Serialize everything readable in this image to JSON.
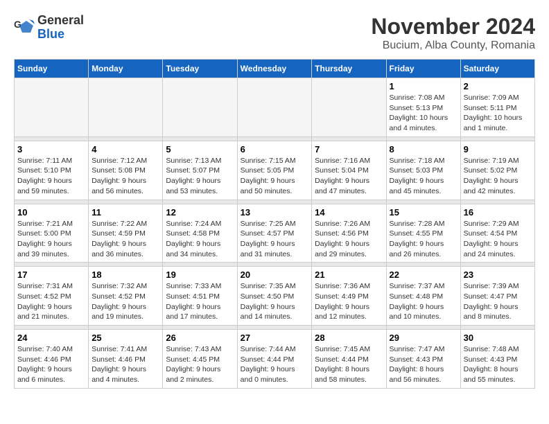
{
  "logo": {
    "general": "General",
    "blue": "Blue"
  },
  "title": "November 2024",
  "subtitle": "Bucium, Alba County, Romania",
  "headers": [
    "Sunday",
    "Monday",
    "Tuesday",
    "Wednesday",
    "Thursday",
    "Friday",
    "Saturday"
  ],
  "weeks": [
    [
      {
        "day": "",
        "info": ""
      },
      {
        "day": "",
        "info": ""
      },
      {
        "day": "",
        "info": ""
      },
      {
        "day": "",
        "info": ""
      },
      {
        "day": "",
        "info": ""
      },
      {
        "day": "1",
        "info": "Sunrise: 7:08 AM\nSunset: 5:13 PM\nDaylight: 10 hours\nand 4 minutes."
      },
      {
        "day": "2",
        "info": "Sunrise: 7:09 AM\nSunset: 5:11 PM\nDaylight: 10 hours\nand 1 minute."
      }
    ],
    [
      {
        "day": "3",
        "info": "Sunrise: 7:11 AM\nSunset: 5:10 PM\nDaylight: 9 hours\nand 59 minutes."
      },
      {
        "day": "4",
        "info": "Sunrise: 7:12 AM\nSunset: 5:08 PM\nDaylight: 9 hours\nand 56 minutes."
      },
      {
        "day": "5",
        "info": "Sunrise: 7:13 AM\nSunset: 5:07 PM\nDaylight: 9 hours\nand 53 minutes."
      },
      {
        "day": "6",
        "info": "Sunrise: 7:15 AM\nSunset: 5:05 PM\nDaylight: 9 hours\nand 50 minutes."
      },
      {
        "day": "7",
        "info": "Sunrise: 7:16 AM\nSunset: 5:04 PM\nDaylight: 9 hours\nand 47 minutes."
      },
      {
        "day": "8",
        "info": "Sunrise: 7:18 AM\nSunset: 5:03 PM\nDaylight: 9 hours\nand 45 minutes."
      },
      {
        "day": "9",
        "info": "Sunrise: 7:19 AM\nSunset: 5:02 PM\nDaylight: 9 hours\nand 42 minutes."
      }
    ],
    [
      {
        "day": "10",
        "info": "Sunrise: 7:21 AM\nSunset: 5:00 PM\nDaylight: 9 hours\nand 39 minutes."
      },
      {
        "day": "11",
        "info": "Sunrise: 7:22 AM\nSunset: 4:59 PM\nDaylight: 9 hours\nand 36 minutes."
      },
      {
        "day": "12",
        "info": "Sunrise: 7:24 AM\nSunset: 4:58 PM\nDaylight: 9 hours\nand 34 minutes."
      },
      {
        "day": "13",
        "info": "Sunrise: 7:25 AM\nSunset: 4:57 PM\nDaylight: 9 hours\nand 31 minutes."
      },
      {
        "day": "14",
        "info": "Sunrise: 7:26 AM\nSunset: 4:56 PM\nDaylight: 9 hours\nand 29 minutes."
      },
      {
        "day": "15",
        "info": "Sunrise: 7:28 AM\nSunset: 4:55 PM\nDaylight: 9 hours\nand 26 minutes."
      },
      {
        "day": "16",
        "info": "Sunrise: 7:29 AM\nSunset: 4:54 PM\nDaylight: 9 hours\nand 24 minutes."
      }
    ],
    [
      {
        "day": "17",
        "info": "Sunrise: 7:31 AM\nSunset: 4:52 PM\nDaylight: 9 hours\nand 21 minutes."
      },
      {
        "day": "18",
        "info": "Sunrise: 7:32 AM\nSunset: 4:52 PM\nDaylight: 9 hours\nand 19 minutes."
      },
      {
        "day": "19",
        "info": "Sunrise: 7:33 AM\nSunset: 4:51 PM\nDaylight: 9 hours\nand 17 minutes."
      },
      {
        "day": "20",
        "info": "Sunrise: 7:35 AM\nSunset: 4:50 PM\nDaylight: 9 hours\nand 14 minutes."
      },
      {
        "day": "21",
        "info": "Sunrise: 7:36 AM\nSunset: 4:49 PM\nDaylight: 9 hours\nand 12 minutes."
      },
      {
        "day": "22",
        "info": "Sunrise: 7:37 AM\nSunset: 4:48 PM\nDaylight: 9 hours\nand 10 minutes."
      },
      {
        "day": "23",
        "info": "Sunrise: 7:39 AM\nSunset: 4:47 PM\nDaylight: 9 hours\nand 8 minutes."
      }
    ],
    [
      {
        "day": "24",
        "info": "Sunrise: 7:40 AM\nSunset: 4:46 PM\nDaylight: 9 hours\nand 6 minutes."
      },
      {
        "day": "25",
        "info": "Sunrise: 7:41 AM\nSunset: 4:46 PM\nDaylight: 9 hours\nand 4 minutes."
      },
      {
        "day": "26",
        "info": "Sunrise: 7:43 AM\nSunset: 4:45 PM\nDaylight: 9 hours\nand 2 minutes."
      },
      {
        "day": "27",
        "info": "Sunrise: 7:44 AM\nSunset: 4:44 PM\nDaylight: 9 hours\nand 0 minutes."
      },
      {
        "day": "28",
        "info": "Sunrise: 7:45 AM\nSunset: 4:44 PM\nDaylight: 8 hours\nand 58 minutes."
      },
      {
        "day": "29",
        "info": "Sunrise: 7:47 AM\nSunset: 4:43 PM\nDaylight: 8 hours\nand 56 minutes."
      },
      {
        "day": "30",
        "info": "Sunrise: 7:48 AM\nSunset: 4:43 PM\nDaylight: 8 hours\nand 55 minutes."
      }
    ]
  ]
}
